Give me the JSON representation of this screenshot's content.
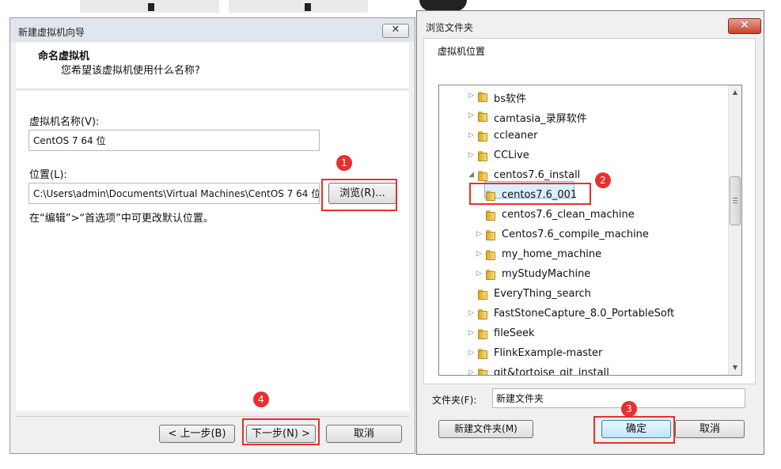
{
  "left_window": {
    "title": "新建虚拟机向导",
    "close_symbol": "✕",
    "header_title": "命名虚拟机",
    "header_subtitle": "您希望该虚拟机使用什么名称?",
    "vm_name_label": "虚拟机名称(V):",
    "vm_name_value": "CentOS 7 64 位",
    "location_label": "位置(L):",
    "location_value": "C:\\Users\\admin\\Documents\\Virtual Machines\\CentOS 7 64 位",
    "browse_button": "浏览(R)...",
    "hint_text": "在“编辑”>“首选项”中可更改默认位置。",
    "back_button": "< 上一步(B)",
    "next_button": "下一步(N) >",
    "cancel_button": "取消"
  },
  "right_window": {
    "title": "浏览文件夹",
    "close_symbol": "✕",
    "description": "虚拟机位置",
    "tree_items": [
      {
        "label": "bs软件",
        "expander": "▷"
      },
      {
        "label": "camtasia_录屏软件",
        "expander": "▷"
      },
      {
        "label": "ccleaner",
        "expander": "▷"
      },
      {
        "label": "CCLive",
        "expander": "▷"
      },
      {
        "label": "centos7.6_install",
        "expander": "◢"
      },
      {
        "label": "centos7.6_001",
        "expander": ""
      },
      {
        "label": "centos7.6_clean_machine",
        "expander": ""
      },
      {
        "label": "Centos7.6_compile_machine",
        "expander": "▷"
      },
      {
        "label": "my_home_machine",
        "expander": "▷"
      },
      {
        "label": "myStudyMachine",
        "expander": "▷"
      },
      {
        "label": "EveryThing_search",
        "expander": ""
      },
      {
        "label": "FastStoneCapture_8.0_PortableSoft",
        "expander": "▷"
      },
      {
        "label": "fileSeek",
        "expander": "▷"
      },
      {
        "label": "FlinkExample-master",
        "expander": "▷"
      },
      {
        "label": "git&tortoise_git_install",
        "expander": "▷"
      }
    ],
    "scroll_up": "▲",
    "scroll_down": "▼",
    "folder_label": "文件夹(F):",
    "folder_value": "新建文件夹",
    "new_folder_button": "新建文件夹(M)",
    "ok_button": "确定",
    "cancel_button": "取消"
  },
  "annotations": {
    "badge_1": "1",
    "badge_2": "2",
    "badge_3": "3",
    "badge_4": "4"
  },
  "colors": {
    "annotation_red": "#e8302e",
    "selection_blue": "#dbeefb"
  }
}
